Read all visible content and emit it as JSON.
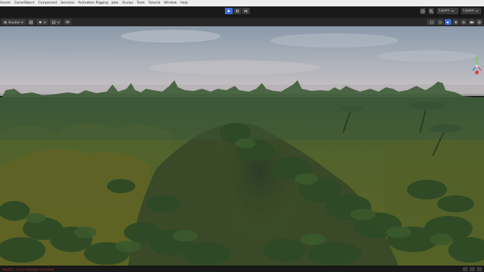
{
  "menu": {
    "items": [
      "Assets",
      "GameObject",
      "Component",
      "Services",
      "Animation Rigging",
      "Jobs",
      "Oculus",
      "Tools",
      "Tutorial",
      "Window",
      "Help"
    ]
  },
  "toolbar": {
    "play_icon": "play-icon",
    "pause_icon": "pause-icon",
    "step_icon": "step-icon",
    "layers_label": "Layers",
    "layout_label": "Layout",
    "accent_color": "#3b6bd8"
  },
  "scene_header": {
    "shading_mode": "Shaded"
  },
  "status": {
    "message": "Assets/... error message truncated"
  }
}
